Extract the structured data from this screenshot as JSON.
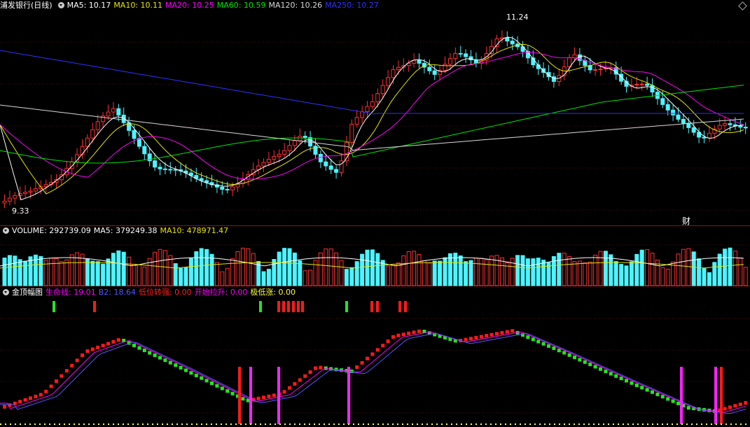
{
  "price_panel": {
    "title": "浦发银行(日线)",
    "ma": [
      {
        "label": "MA5: 10.17",
        "color": "#ffffff"
      },
      {
        "label": "MA10: 10.11",
        "color": "#e6e600"
      },
      {
        "label": "MA20: 10.25",
        "color": "#ff00ff"
      },
      {
        "label": "MA60: 10.59",
        "color": "#00e600"
      },
      {
        "label": "MA120: 10.26",
        "color": "#d8d8d8"
      },
      {
        "label": "MA250: 10.27",
        "color": "#3030ff"
      }
    ],
    "high_label": "11.24",
    "low_label": "9.33",
    "finance_tag": "财"
  },
  "volume_panel": {
    "title": "VOLUME: 292739.09",
    "ma5": "MA5: 379249.38",
    "ma10": "MA10: 478971.47"
  },
  "indicator_panel": {
    "title": "金顶幅图",
    "items": [
      {
        "label": "生命线: 19.01",
        "color": "#ff00ff"
      },
      {
        "label": "B2: 18.64",
        "color": "#5555ff"
      },
      {
        "label": "低位转强: 0.00",
        "color": "#ff2020"
      },
      {
        "label": "开始拉升: 0.00",
        "color": "#ff00ff"
      },
      {
        "label": "极低涨: 0.00",
        "color": "#ffff40"
      }
    ]
  },
  "colors": {
    "up": "#ff3030",
    "down": "#4cf4ff",
    "ma5": "#ffffff",
    "ma10": "#e6e600",
    "ma20": "#ff00ff",
    "ma60": "#00e600",
    "ma120": "#d8d8d8",
    "ma250": "#3030ff",
    "grid": "#5a0a0a"
  }
}
